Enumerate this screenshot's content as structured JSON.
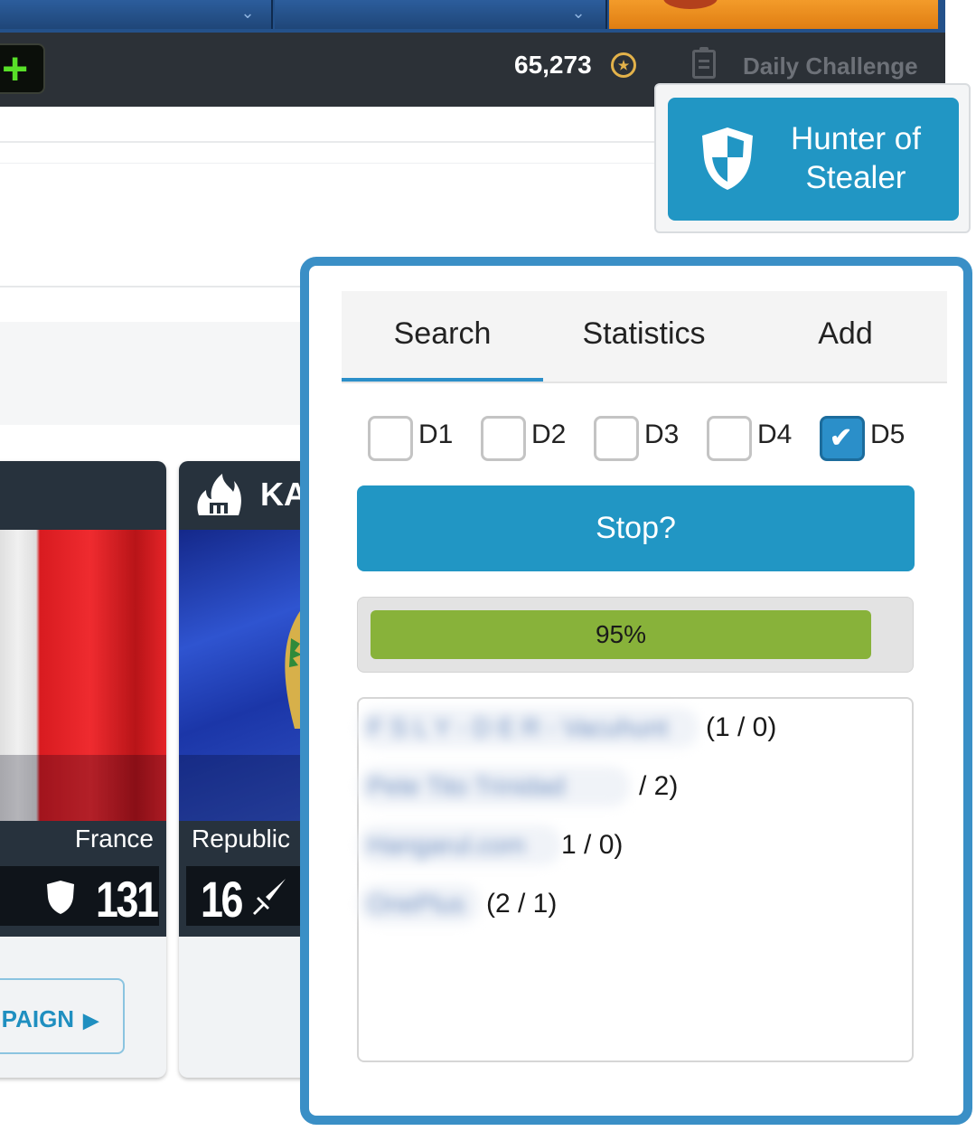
{
  "top_bar": {
    "coins": "65,273",
    "daily_challenge_label": "Daily Challenge"
  },
  "faction_cards": [
    {
      "name": "France",
      "stat_value": "131",
      "stat_icon": "shield-icon",
      "flag_colors": [
        "#e9e9e9",
        "#d81b20"
      ]
    },
    {
      "name": "Republic",
      "stat_value": "16",
      "stat_icon": "sword-icon",
      "title_fragment": "KA",
      "flag_colors": [
        "#1f3a9e",
        "#2a57c9"
      ]
    }
  ],
  "campaign_button_label": "MPAIGN",
  "hunter_button": {
    "label": "Hunter of Stealer",
    "icon": "shield-icon"
  },
  "panel": {
    "tabs": [
      {
        "label": "Search",
        "active": true
      },
      {
        "label": "Statistics",
        "active": false
      },
      {
        "label": "Add",
        "active": false
      }
    ],
    "difficulties": [
      {
        "label": "D1",
        "checked": false
      },
      {
        "label": "D2",
        "checked": false
      },
      {
        "label": "D3",
        "checked": false
      },
      {
        "label": "D4",
        "checked": false
      },
      {
        "label": "D5",
        "checked": true
      }
    ],
    "checkmark": "✔",
    "stop_button_label": "Stop?",
    "progress": {
      "value": 0.95,
      "label": "95%"
    },
    "results": [
      {
        "name": "F S L Y - D E R - Vacuhunt",
        "count": "(1 / 0)"
      },
      {
        "name": "Pete Tito Trinidad",
        "count": "/ 2)"
      },
      {
        "name": "Hangarul.com",
        "count": "1 / 0)"
      },
      {
        "name": "OnePlus",
        "count": "(2 / 1)"
      }
    ]
  },
  "colors": {
    "accent": "#2196c4",
    "panel_border": "#3a8fc6",
    "progress_fill": "#88b23a",
    "top_bar": "#2c3137"
  }
}
